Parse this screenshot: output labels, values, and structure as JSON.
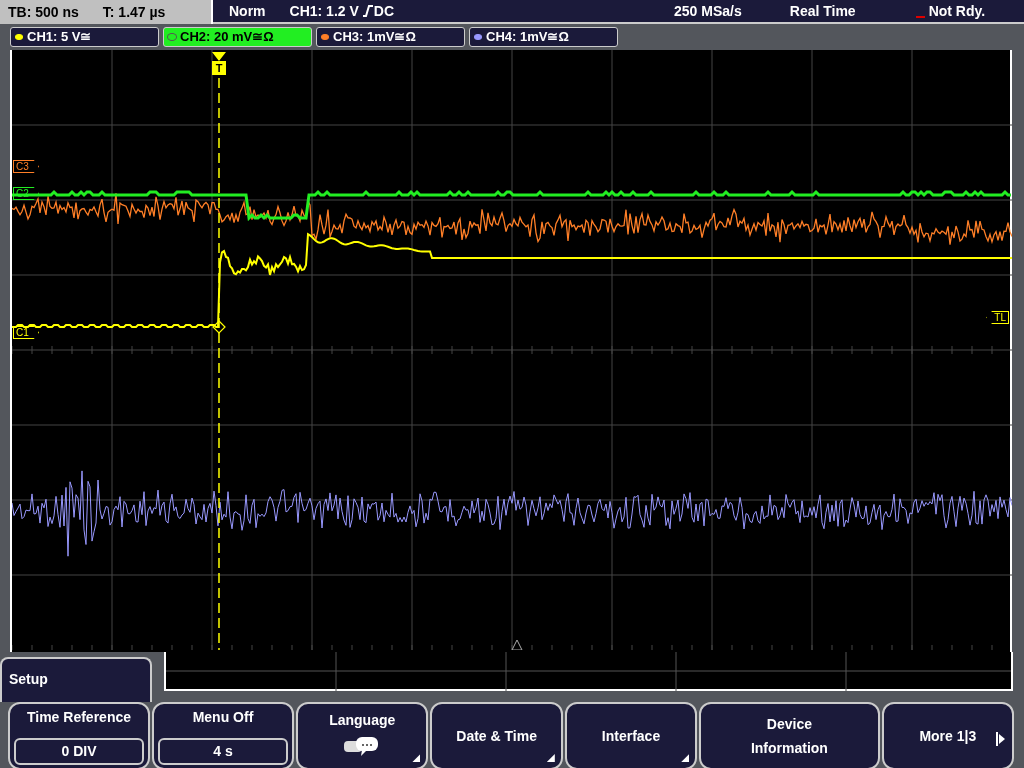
{
  "status_bar": {
    "timebase": "TB: 500 ns",
    "trigger_time": "T: 1.47 µs",
    "mode": "Norm",
    "trigger": "CH1: 1.2 V",
    "coupling": "DC",
    "sample_rate": "250 MSa/s",
    "acquisition": "Real Time",
    "state": "Not Rdy."
  },
  "channels": [
    {
      "label": "CH1: 5 V≅",
      "color": "#ffff00",
      "selected": false
    },
    {
      "label": "CH2: 20 mV≅Ω",
      "color": "#22ee22",
      "selected": true
    },
    {
      "label": "CH3: 1mV≅Ω",
      "color": "#ff7f27",
      "selected": false
    },
    {
      "label": "CH4: 1mV≅Ω",
      "color": "#9999ff",
      "selected": false
    }
  ],
  "display": {
    "trigger_marker": "T",
    "level_marker": "TL",
    "channel_markers": [
      {
        "label": "C3",
        "color": "#ff7f27"
      },
      {
        "label": "C2",
        "color": "#22ee22"
      },
      {
        "label": "C1",
        "color": "#ffff00"
      }
    ]
  },
  "menu": {
    "title": "Setup",
    "buttons": [
      {
        "kind": "value",
        "label": "Time Reference",
        "value": "0 DIV"
      },
      {
        "kind": "value",
        "label": "Menu Off",
        "value": "4 s"
      },
      {
        "kind": "icon",
        "label": "Language"
      },
      {
        "kind": "submenu",
        "label": "Date & Time"
      },
      {
        "kind": "submenu",
        "label": "Interface"
      },
      {
        "kind": "plain",
        "label": "Device Information"
      },
      {
        "kind": "next",
        "label": "More 1|3"
      }
    ]
  }
}
